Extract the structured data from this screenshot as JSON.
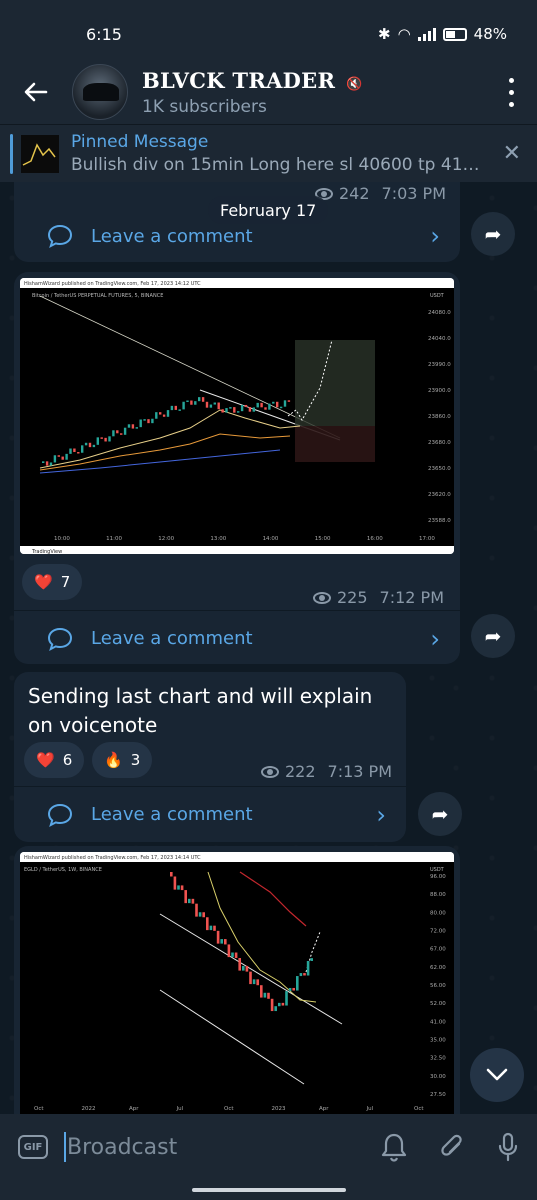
{
  "status": {
    "time": "6:15",
    "battery": "48%"
  },
  "header": {
    "channel_name": "BLVCK TRADER",
    "subscribers": "1K subscribers"
  },
  "pinned": {
    "title": "Pinned Message",
    "message": "Bullish div on 15min  Long here sl 40600 tp 41…"
  },
  "date_separator": "February 17",
  "posts": [
    {
      "views": "242",
      "time": "7:03 PM",
      "comment_label": "Leave a comment"
    },
    {
      "views": "225",
      "time": "7:12 PM",
      "comment_label": "Leave a comment",
      "reactions": [
        {
          "emoji": "❤️",
          "count": "7"
        }
      ],
      "chart": {
        "header": "HishamWizard published on TradingView.com, Feb 17, 2023 14:12 UTC",
        "symbol": "Bitcoin / TetherUS PERPETUAL FUTURES, 5, BINANCE",
        "currency": "USDT",
        "footer": "TradingView",
        "x_ticks": [
          "10:00",
          "11:00",
          "12:00",
          "13:00",
          "14:00",
          "15:00",
          "16:00",
          "17:00"
        ],
        "y_ticks": [
          "24080.0",
          "24040.0",
          "23990.0",
          "23900.0",
          "23860.0",
          "23680.0",
          "23650.0",
          "23620.0",
          "23588.0"
        ]
      }
    },
    {
      "text": "Sending last chart and will explain on voicenote",
      "views": "222",
      "time": "7:13 PM",
      "comment_label": "Leave a comment",
      "reactions": [
        {
          "emoji": "❤️",
          "count": "6"
        },
        {
          "emoji": "🔥",
          "count": "3"
        }
      ]
    },
    {
      "chart": {
        "header": "HishamWizard published on TradingView.com, Feb 17, 2023 14:14 UTC",
        "symbol": "EGLD / TetherUS, 1W, BINANCE",
        "currency": "USDT",
        "x_ticks": [
          "Oct",
          "2022",
          "Apr",
          "Jul",
          "Oct",
          "2023",
          "Apr",
          "Jul",
          "Oct"
        ],
        "y_ticks": [
          "96.00",
          "88.00",
          "80.00",
          "72.00",
          "67.00",
          "62.00",
          "56.00",
          "52.00",
          "41.00",
          "35.00",
          "32.50",
          "30.00",
          "27.50"
        ]
      }
    }
  ],
  "input": {
    "gif_label": "GIF",
    "placeholder": "Broadcast"
  }
}
